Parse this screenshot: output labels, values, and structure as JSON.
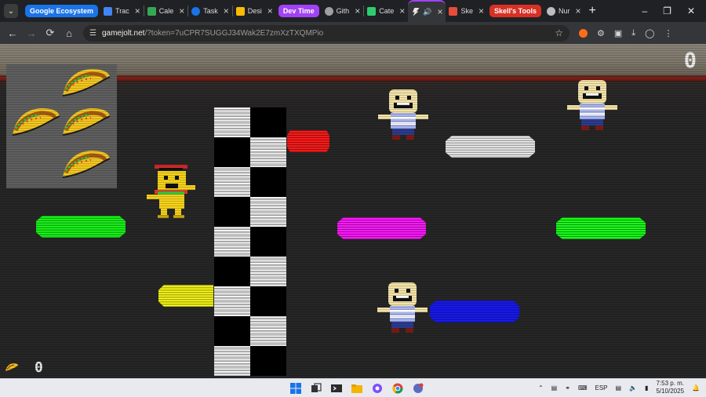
{
  "browser": {
    "tab_search_icon": "chevron-down-icon",
    "groups": [
      {
        "label": "Google Ecosystem",
        "color": "#1a73e8"
      },
      {
        "label": "Dev Time",
        "color": "#a142f4"
      },
      {
        "label": "Skell's Tools",
        "color": "#d93025"
      }
    ],
    "tabs": [
      {
        "title": "Trac",
        "favicon_color": "#4285f4"
      },
      {
        "title": "Cale",
        "favicon_color": "#34a853"
      },
      {
        "title": "Task",
        "favicon_color": "#1a73e8"
      },
      {
        "title": "Desi",
        "favicon_color": "#fbbc04"
      },
      {
        "title": "Gith",
        "favicon_color": "#9aa0a6"
      },
      {
        "title": "Cate",
        "favicon_color": "#2ecc71"
      },
      {
        "title": "•",
        "favicon_color": "#e8e8e8"
      },
      {
        "title": "Ske",
        "favicon_color": "#e44d3a"
      },
      {
        "title": "Nur",
        "favicon_color": "#bdbdbd"
      }
    ],
    "url_domain": "gamejolt.net",
    "url_path": "/?token=7uCPR7SUGGJ34Wak2E7zmXzTXQMPio"
  },
  "game": {
    "score": "0",
    "taco_count": "0",
    "colors": {
      "red": "#ff1a1a",
      "white": "#f2f2f2",
      "green": "#19ff19",
      "magenta": "#ff19ff",
      "yellow": "#ffff19",
      "blue": "#1a1aff"
    }
  },
  "taskbar": {
    "language": "ESP",
    "time": "7:53 p. m.",
    "date": "5/10/2025"
  }
}
